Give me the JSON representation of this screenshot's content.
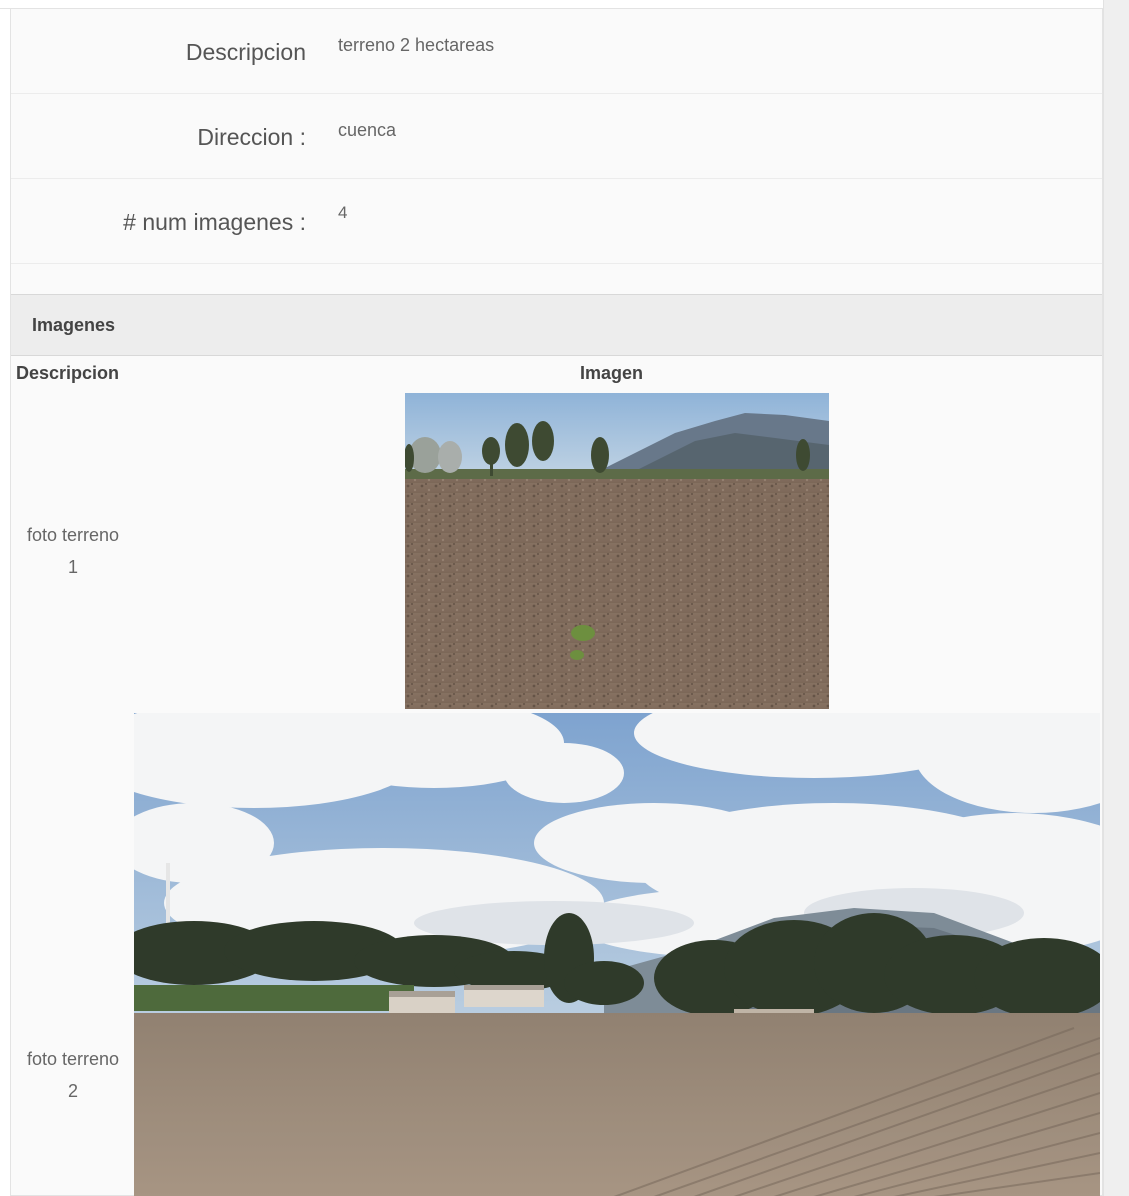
{
  "details": {
    "description_label": "Descripcion",
    "description_value": "terreno 2 hectareas",
    "address_label": "Direccion :",
    "address_value": "cuenca",
    "num_images_label": "# num imagenes :",
    "num_images_value": "4"
  },
  "images_section": {
    "title": "Imagenes",
    "columns": {
      "description": "Descripcion",
      "image": "Imagen"
    },
    "rows": [
      {
        "description_line1": "foto terreno",
        "description_line2": "1",
        "image": "field-photo-1"
      },
      {
        "description_line1": "foto terreno",
        "description_line2": "2",
        "image": "field-photo-2"
      }
    ]
  }
}
